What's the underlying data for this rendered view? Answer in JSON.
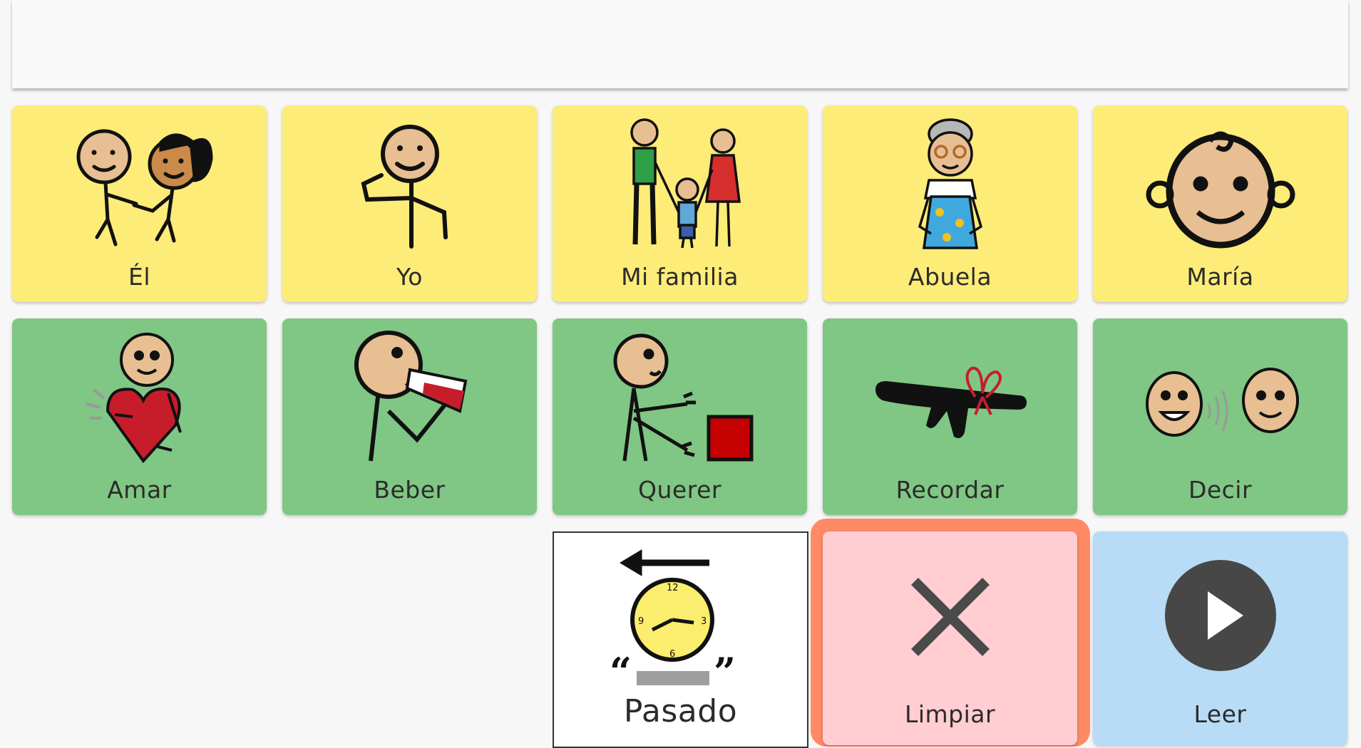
{
  "message_bar": {
    "text": ""
  },
  "tiles_row1": [
    {
      "label": "Él",
      "icon": "two-people-pointing-icon"
    },
    {
      "label": "Yo",
      "icon": "person-pointing-self-icon"
    },
    {
      "label": "Mi familia",
      "icon": "family-icon"
    },
    {
      "label": "Abuela",
      "icon": "grandmother-icon"
    },
    {
      "label": "María",
      "icon": "girl-face-icon"
    }
  ],
  "tiles_row2": [
    {
      "label": "Amar",
      "icon": "person-hugging-heart-icon"
    },
    {
      "label": "Beber",
      "icon": "person-drinking-icon"
    },
    {
      "label": "Querer",
      "icon": "person-reaching-box-icon"
    },
    {
      "label": "Recordar",
      "icon": "finger-with-ribbon-icon"
    },
    {
      "label": "Decir",
      "icon": "two-faces-talking-icon"
    }
  ],
  "controls": {
    "past": {
      "label": "Pasado",
      "icon": "clock-past-arrow-icon"
    },
    "clear": {
      "label": "Limpiar",
      "icon": "close-icon"
    },
    "read": {
      "label": "Leer",
      "icon": "play-icon"
    }
  },
  "colors": {
    "people": "#fdec78",
    "verbs": "#80c684",
    "clear": "#ffcdd2",
    "clear_highlight": "#ff8a65",
    "read": "#b8dcf5"
  }
}
